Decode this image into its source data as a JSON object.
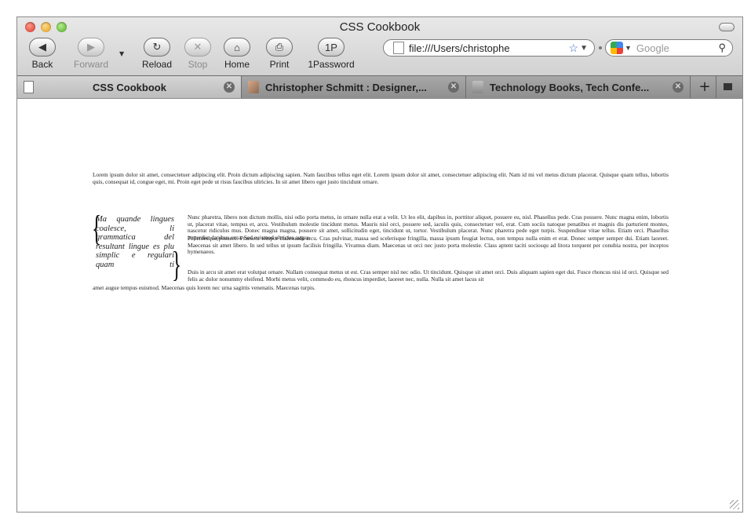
{
  "window": {
    "title": "CSS Cookbook"
  },
  "toolbar": {
    "back_label": "Back",
    "forward_label": "Forward",
    "reload_label": "Reload",
    "stop_label": "Stop",
    "home_label": "Home",
    "print_label": "Print",
    "password_label": "1Password",
    "password_icon_text": "1P"
  },
  "address_bar": {
    "url": "file:///Users/christophe"
  },
  "search_bar": {
    "placeholder": "Google"
  },
  "tabs": [
    {
      "label": "CSS Cookbook",
      "icon": "document-icon",
      "active": true
    },
    {
      "label": "Christopher Schmitt : Designer,...",
      "icon": "photo-favicon",
      "active": false
    },
    {
      "label": "Technology Books, Tech Confe...",
      "icon": "books-favicon",
      "active": false
    }
  ],
  "content": {
    "intro": "Lorem ipsum dolor sit amet, consectetuer adipiscing elit. Proin dictum adipiscing sapien. Nam faucibus tellus eget elit. Lorem ipsum dolor sit amet, consectetuer adipiscing elit. Nam id mi vel metus dictum placerat. Quisque quam tellus, lobortis quis, consequat id, congue eget, mi. Proin eget pede ut risus faucibus ultricies. In sit amet libero eget justo tincidunt ornare.",
    "pullquote": "Ma quande lingues coalesce, li grammatica del resultant lingue es plu simplic e regulari quam ti",
    "nunc": "Nunc pharetra, libero non dictum mollis, nisi odio porta metus, in ornare nulla erat a velit. Ut leo elit, dapibus in, porttitor aliquet, posuere eu, nisl. Phasellus pede. Cras posuere. Nunc magna enim, lobortis ut, placerat vitae, tempus et, arcu. Vestibulum molestie tincidunt metus. Mauris nisl orci, posuere sed, iaculis quis, consectetuer vel, erat. Cum sociis natoque penatibus et magnis dis parturient montes, nascetur ridiculus mus. Donec magna magna, posuere sit amet, sollicitudin eget, tincidunt ut, tortor. Vestibulum placerat. Nunc pharetra pede eget turpis. Suspendisse vitae tellus. Etiam orci. Phasellus imperdiet dapibus urna. Sed euismod ultricies augue.",
    "pellentesque": "Pellentesque posuere. Praesent tempor malesuada arcu. Cras pulvinar, massa sed scelerisque fringilla, massa ipsum feugiat lectus, non tempus nulla enim et erat. Donec semper semper dui. Etiam laoreet. Maecenas sit amet libero. In sed tellus ut ipsum facilisis fringilla. Vivamus diam. Maecenas ut orci nec justo porta molestie. Class aptent taciti sociosqu ad litora torquent per conubia nostra, per inceptos hymenaeos.",
    "duis": "Duis in arcu sit amet erat volutpat ornare. Nullam consequat metus ut est. Cras semper nisl nec odio. Ut tincidunt. Quisque sit amet orci. Duis aliquam sapien eget dui. Fusce rhoncus nisi id orci. Quisque sed felis ac dolor nonummy eleifend. Morbi metus velit, commodo eu, rhoncus imperdiet, laoreet nec, nulla. Nulla sit amet lacus sit",
    "tail": "amet augue tempus euismod. Maecenas quis lorem nec urna sagittis venenatis. Maecenas turpis."
  }
}
